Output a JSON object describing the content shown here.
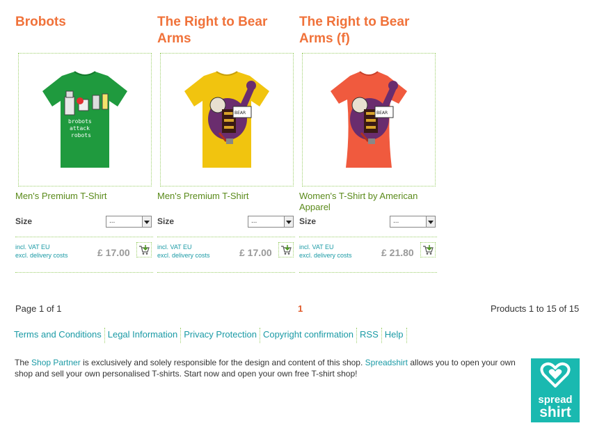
{
  "products": [
    {
      "title": "Brobots",
      "type": "Men's Premium T-Shirt",
      "size_label": "Size",
      "size_value": "...",
      "vat": "incl. VAT EU",
      "delivery": "excl. delivery costs",
      "price": "£ 17.00",
      "shirt_color": "#1f9a3e",
      "design": "robots"
    },
    {
      "title": "The Right to Bear Arms",
      "type": "Men's Premium T-Shirt",
      "size_label": "Size",
      "size_value": "...",
      "vat": "incl. VAT EU",
      "delivery": "excl. delivery costs",
      "price": "£ 17.00",
      "shirt_color": "#f1c40f",
      "design": "bear"
    },
    {
      "title": "The Right to Bear Arms (f)",
      "type": "Women's T-Shirt by American Apparel",
      "size_label": "Size",
      "size_value": "...",
      "vat": "incl. VAT EU",
      "delivery": "excl. delivery costs",
      "price": "£ 21.80",
      "shirt_color": "#f05a3e",
      "design": "bear"
    }
  ],
  "pagination": {
    "page_text": "Page 1 of 1",
    "current_page": "1",
    "products_text": "Products 1 to 15 of 15"
  },
  "footer": {
    "links": [
      "Terms and Conditions",
      "Legal Information",
      "Privacy Protection",
      "Copyright confirmation",
      "RSS",
      "Help"
    ],
    "about_pre": "The ",
    "about_link1": "Shop Partner",
    "about_mid": " is exclusively and solely responsible for the design and content of this shop. ",
    "about_link2": "Spreadshirt",
    "about_post": " allows you to open your own shop and sell your own personalised T-shirts. Start now and open your own free T-shirt shop!",
    "logo_line1": "spread",
    "logo_line2": "shirt"
  },
  "colors": {
    "title": "#f0723a",
    "link": "#1a9aa5",
    "product_type": "#5a8a1a",
    "logo_bg": "#1ab9b0"
  }
}
